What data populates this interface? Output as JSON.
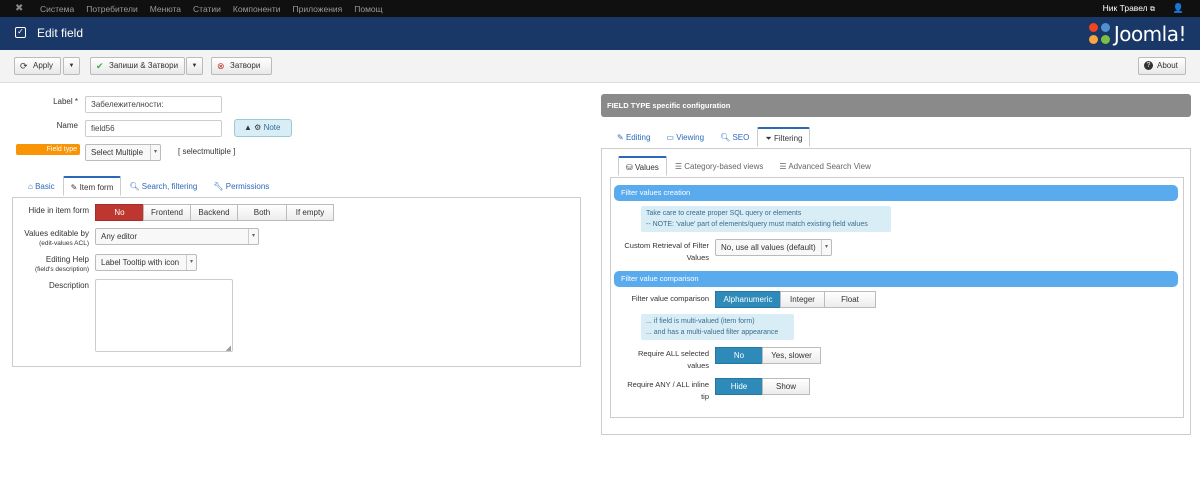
{
  "topnav": {
    "menu": [
      "Система",
      "Потребители",
      "Менюта",
      "Статии",
      "Компоненти",
      "Приложения",
      "Помощ"
    ],
    "user_name": "Ник Травел",
    "external_icon": "external-link-icon",
    "user_icon": "user-icon"
  },
  "header": {
    "title": "Edit field",
    "brand": "Joomla!",
    "brand_colors": [
      "#f44321",
      "#5091cd",
      "#f9a541",
      "#7ac143"
    ]
  },
  "toolbar": {
    "apply": "Apply",
    "save_close": "Запиши & Затвори",
    "close": "Затвори",
    "about": "About"
  },
  "form": {
    "label_label": "Label *",
    "label_value": "Забележителности:",
    "name_label": "Name",
    "name_value": "field56",
    "note_label": "Note",
    "field_type_label": "Field type",
    "field_type_value": "Select Multiple",
    "field_type_code": "[ selectmultiple ]"
  },
  "left_tabs": [
    "Basic",
    "Item form",
    "Search, filtering",
    "Permissions"
  ],
  "item_form": {
    "hide_label": "Hide in item form",
    "hide_options": [
      "No",
      "Frontend",
      "Backend",
      "Both",
      "If empty"
    ],
    "values_editable_label": "Values editable by",
    "values_editable_sub": "(edit-values ACL)",
    "values_editable_value": "Any editor",
    "editing_help_label": "Editing Help",
    "editing_help_sub": "(field's description)",
    "editing_help_value": "Label Tooltip with icon",
    "description_label": "Description"
  },
  "right_panel": {
    "header": "FIELD TYPE specific configuration",
    "tabs": [
      "Editing",
      "Viewing",
      "SEO",
      "Filtering"
    ],
    "subtabs": [
      "Values",
      "Category-based views",
      "Advanced Search View"
    ],
    "sec1": "Filter values creation",
    "info1_line1": "Take care to create proper SQL query or elements",
    "info1_line2": "-- NOTE: 'value' part of elements/query must match existing field values",
    "custom_retrieval_label_1": "Custom Retrieval of Filter",
    "custom_retrieval_label_2": "Values",
    "custom_retrieval_value": "No, use all values (default)",
    "sec2": "Filter value comparison",
    "comparison_label": "Filter value comparison",
    "comparison_options": [
      "Alphanumeric",
      "Integer",
      "Float"
    ],
    "info2_line1": "... if field is multi-valued (item form)",
    "info2_line2": "... and has a multi-valued filter appearance",
    "require_all_label_1": "Require ALL selected",
    "require_all_label_2": "values",
    "require_all_options": [
      "No",
      "Yes, slower"
    ],
    "require_tip_label_1": "Require ANY / ALL inline",
    "require_tip_label_2": "tip",
    "require_tip_options": [
      "Hide",
      "Show"
    ]
  }
}
